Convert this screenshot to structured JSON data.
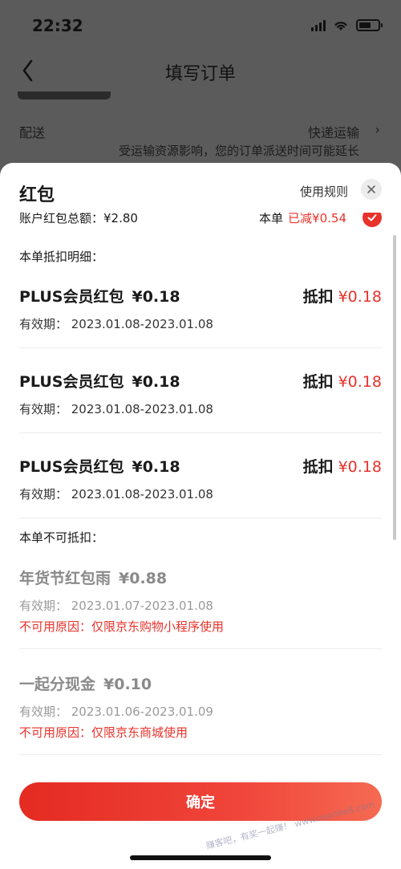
{
  "status_bar": {
    "time": "22:32"
  },
  "background_page": {
    "title": "填写订单",
    "shipping_label": "配送",
    "shipping_method": "快递运输",
    "shipping_note": "受运输资源影响，您的订单派送时间可能延长"
  },
  "sheet": {
    "title": "红包",
    "rules_link": "使用规则",
    "summary": {
      "total_label": "账户红包总额：",
      "total_value": "¥2.80",
      "order_label": "本单",
      "order_deducted": "已减¥0.54"
    },
    "applicable_title": "本单抵扣明细：",
    "applicable": [
      {
        "name": "PLUS会员红包",
        "amount": "¥0.18",
        "deduct_label": "抵扣",
        "deduct_value": "¥0.18",
        "validity": "有效期：  2023.01.08-2023.01.08"
      },
      {
        "name": "PLUS会员红包",
        "amount": "¥0.18",
        "deduct_label": "抵扣",
        "deduct_value": "¥0.18",
        "validity": "有效期：  2023.01.08-2023.01.08"
      },
      {
        "name": "PLUS会员红包",
        "amount": "¥0.18",
        "deduct_label": "抵扣",
        "deduct_value": "¥0.18",
        "validity": "有效期：  2023.01.08-2023.01.08"
      }
    ],
    "unavailable_title": "本单不可抵扣：",
    "unavailable": [
      {
        "name": "年货节红包雨",
        "amount": "¥0.88",
        "validity": "有效期：  2023.01.07-2023.01.08",
        "reason": "不可用原因：仅限京东购物小程序使用"
      },
      {
        "name": "一起分现金",
        "amount": "¥0.10",
        "validity": "有效期：  2023.01.06-2023.01.09",
        "reason": "不可用原因：仅限京东商城使用"
      }
    ],
    "confirm_label": "确定",
    "watermark": "赚客吧，有奖一起赚！ www.zuanke8.com"
  },
  "colors": {
    "accent": "#e8322b",
    "overlay": "#5b5b5b"
  }
}
